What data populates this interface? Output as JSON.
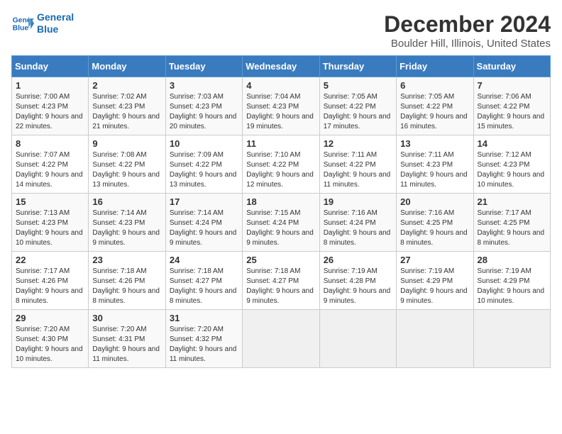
{
  "logo": {
    "line1": "General",
    "line2": "Blue"
  },
  "title": "December 2024",
  "location": "Boulder Hill, Illinois, United States",
  "days_of_week": [
    "Sunday",
    "Monday",
    "Tuesday",
    "Wednesday",
    "Thursday",
    "Friday",
    "Saturday"
  ],
  "weeks": [
    [
      {
        "day": "1",
        "sunrise": "7:00 AM",
        "sunset": "4:23 PM",
        "daylight": "9 hours and 22 minutes."
      },
      {
        "day": "2",
        "sunrise": "7:02 AM",
        "sunset": "4:23 PM",
        "daylight": "9 hours and 21 minutes."
      },
      {
        "day": "3",
        "sunrise": "7:03 AM",
        "sunset": "4:23 PM",
        "daylight": "9 hours and 20 minutes."
      },
      {
        "day": "4",
        "sunrise": "7:04 AM",
        "sunset": "4:23 PM",
        "daylight": "9 hours and 19 minutes."
      },
      {
        "day": "5",
        "sunrise": "7:05 AM",
        "sunset": "4:22 PM",
        "daylight": "9 hours and 17 minutes."
      },
      {
        "day": "6",
        "sunrise": "7:05 AM",
        "sunset": "4:22 PM",
        "daylight": "9 hours and 16 minutes."
      },
      {
        "day": "7",
        "sunrise": "7:06 AM",
        "sunset": "4:22 PM",
        "daylight": "9 hours and 15 minutes."
      }
    ],
    [
      {
        "day": "8",
        "sunrise": "7:07 AM",
        "sunset": "4:22 PM",
        "daylight": "9 hours and 14 minutes."
      },
      {
        "day": "9",
        "sunrise": "7:08 AM",
        "sunset": "4:22 PM",
        "daylight": "9 hours and 13 minutes."
      },
      {
        "day": "10",
        "sunrise": "7:09 AM",
        "sunset": "4:22 PM",
        "daylight": "9 hours and 13 minutes."
      },
      {
        "day": "11",
        "sunrise": "7:10 AM",
        "sunset": "4:22 PM",
        "daylight": "9 hours and 12 minutes."
      },
      {
        "day": "12",
        "sunrise": "7:11 AM",
        "sunset": "4:22 PM",
        "daylight": "9 hours and 11 minutes."
      },
      {
        "day": "13",
        "sunrise": "7:11 AM",
        "sunset": "4:23 PM",
        "daylight": "9 hours and 11 minutes."
      },
      {
        "day": "14",
        "sunrise": "7:12 AM",
        "sunset": "4:23 PM",
        "daylight": "9 hours and 10 minutes."
      }
    ],
    [
      {
        "day": "15",
        "sunrise": "7:13 AM",
        "sunset": "4:23 PM",
        "daylight": "9 hours and 10 minutes."
      },
      {
        "day": "16",
        "sunrise": "7:14 AM",
        "sunset": "4:23 PM",
        "daylight": "9 hours and 9 minutes."
      },
      {
        "day": "17",
        "sunrise": "7:14 AM",
        "sunset": "4:24 PM",
        "daylight": "9 hours and 9 minutes."
      },
      {
        "day": "18",
        "sunrise": "7:15 AM",
        "sunset": "4:24 PM",
        "daylight": "9 hours and 9 minutes."
      },
      {
        "day": "19",
        "sunrise": "7:16 AM",
        "sunset": "4:24 PM",
        "daylight": "9 hours and 8 minutes."
      },
      {
        "day": "20",
        "sunrise": "7:16 AM",
        "sunset": "4:25 PM",
        "daylight": "9 hours and 8 minutes."
      },
      {
        "day": "21",
        "sunrise": "7:17 AM",
        "sunset": "4:25 PM",
        "daylight": "9 hours and 8 minutes."
      }
    ],
    [
      {
        "day": "22",
        "sunrise": "7:17 AM",
        "sunset": "4:26 PM",
        "daylight": "9 hours and 8 minutes."
      },
      {
        "day": "23",
        "sunrise": "7:18 AM",
        "sunset": "4:26 PM",
        "daylight": "9 hours and 8 minutes."
      },
      {
        "day": "24",
        "sunrise": "7:18 AM",
        "sunset": "4:27 PM",
        "daylight": "9 hours and 8 minutes."
      },
      {
        "day": "25",
        "sunrise": "7:18 AM",
        "sunset": "4:27 PM",
        "daylight": "9 hours and 9 minutes."
      },
      {
        "day": "26",
        "sunrise": "7:19 AM",
        "sunset": "4:28 PM",
        "daylight": "9 hours and 9 minutes."
      },
      {
        "day": "27",
        "sunrise": "7:19 AM",
        "sunset": "4:29 PM",
        "daylight": "9 hours and 9 minutes."
      },
      {
        "day": "28",
        "sunrise": "7:19 AM",
        "sunset": "4:29 PM",
        "daylight": "9 hours and 10 minutes."
      }
    ],
    [
      {
        "day": "29",
        "sunrise": "7:20 AM",
        "sunset": "4:30 PM",
        "daylight": "9 hours and 10 minutes."
      },
      {
        "day": "30",
        "sunrise": "7:20 AM",
        "sunset": "4:31 PM",
        "daylight": "9 hours and 11 minutes."
      },
      {
        "day": "31",
        "sunrise": "7:20 AM",
        "sunset": "4:32 PM",
        "daylight": "9 hours and 11 minutes."
      },
      null,
      null,
      null,
      null
    ]
  ],
  "labels": {
    "sunrise": "Sunrise:",
    "sunset": "Sunset:",
    "daylight": "Daylight:"
  }
}
